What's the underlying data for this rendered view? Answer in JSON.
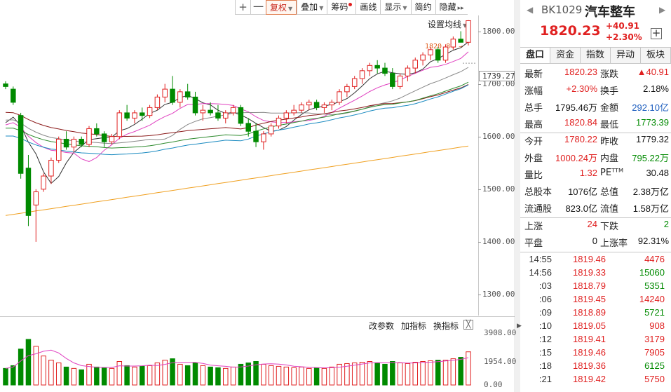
{
  "toolbar": {
    "items": [
      {
        "label": "+"
      },
      {
        "label": "一"
      },
      {
        "label": "复权"
      },
      {
        "label": "叠加"
      },
      {
        "label": "筹码"
      },
      {
        "label": "画线"
      },
      {
        "label": "显示"
      },
      {
        "label": "简约"
      },
      {
        "label": "隐藏"
      }
    ],
    "more": "▸▸"
  },
  "chart": {
    "ma_setting": "设置均线",
    "high_label": "1820.84",
    "current_price": "1739.27",
    "y_ticks": [
      "1800.00",
      "1700.00",
      "1600.00",
      "1500.00",
      "1400.00",
      "1300.00"
    ],
    "indicator_toolbar": {
      "modify_params": "改参数",
      "add_indicator": "加指标",
      "switch_indicator": "换指标"
    },
    "close_symbol": "╳",
    "volume_ticks": [
      "3908.00",
      "1954.00",
      "0.00"
    ]
  },
  "chart_data": {
    "type": "candlestick",
    "ylim": [
      1260,
      1830
    ],
    "ohlc": [
      [
        1700,
        1705,
        1690,
        1695
      ],
      [
        1690,
        1695,
        1660,
        1665
      ],
      [
        1640,
        1645,
        1520,
        1530
      ],
      [
        1540,
        1565,
        1430,
        1450
      ],
      [
        1470,
        1500,
        1400,
        1495
      ],
      [
        1500,
        1530,
        1495,
        1525
      ],
      [
        1525,
        1560,
        1510,
        1555
      ],
      [
        1555,
        1600,
        1550,
        1595
      ],
      [
        1595,
        1610,
        1575,
        1580
      ],
      [
        1580,
        1600,
        1570,
        1595
      ],
      [
        1595,
        1600,
        1580,
        1585
      ],
      [
        1585,
        1620,
        1580,
        1615
      ],
      [
        1615,
        1625,
        1600,
        1605
      ],
      [
        1605,
        1610,
        1580,
        1590
      ],
      [
        1590,
        1605,
        1585,
        1600
      ],
      [
        1600,
        1650,
        1595,
        1645
      ],
      [
        1645,
        1660,
        1630,
        1635
      ],
      [
        1635,
        1650,
        1625,
        1645
      ],
      [
        1645,
        1655,
        1630,
        1640
      ],
      [
        1640,
        1660,
        1635,
        1655
      ],
      [
        1655,
        1680,
        1650,
        1675
      ],
      [
        1675,
        1700,
        1665,
        1690
      ],
      [
        1690,
        1715,
        1660,
        1665
      ],
      [
        1665,
        1690,
        1655,
        1685
      ],
      [
        1685,
        1700,
        1670,
        1675
      ],
      [
        1675,
        1685,
        1640,
        1645
      ],
      [
        1645,
        1660,
        1630,
        1650
      ],
      [
        1650,
        1665,
        1640,
        1645
      ],
      [
        1645,
        1660,
        1630,
        1635
      ],
      [
        1635,
        1650,
        1625,
        1645
      ],
      [
        1645,
        1660,
        1640,
        1655
      ],
      [
        1655,
        1660,
        1620,
        1625
      ],
      [
        1625,
        1635,
        1600,
        1610
      ],
      [
        1610,
        1625,
        1580,
        1590
      ],
      [
        1590,
        1610,
        1575,
        1605
      ],
      [
        1605,
        1625,
        1600,
        1620
      ],
      [
        1620,
        1640,
        1615,
        1635
      ],
      [
        1635,
        1650,
        1625,
        1645
      ],
      [
        1645,
        1660,
        1640,
        1650
      ],
      [
        1650,
        1665,
        1645,
        1660
      ],
      [
        1660,
        1670,
        1650,
        1665
      ],
      [
        1665,
        1670,
        1650,
        1655
      ],
      [
        1655,
        1665,
        1645,
        1660
      ],
      [
        1660,
        1670,
        1650,
        1665
      ],
      [
        1665,
        1690,
        1660,
        1685
      ],
      [
        1685,
        1700,
        1675,
        1695
      ],
      [
        1695,
        1715,
        1690,
        1710
      ],
      [
        1710,
        1730,
        1700,
        1725
      ],
      [
        1725,
        1740,
        1715,
        1735
      ],
      [
        1735,
        1745,
        1720,
        1730
      ],
      [
        1730,
        1740,
        1715,
        1720
      ],
      [
        1720,
        1730,
        1690,
        1695
      ],
      [
        1695,
        1720,
        1690,
        1715
      ],
      [
        1715,
        1735,
        1705,
        1730
      ],
      [
        1730,
        1750,
        1720,
        1745
      ],
      [
        1745,
        1760,
        1735,
        1755
      ],
      [
        1755,
        1770,
        1745,
        1765
      ],
      [
        1765,
        1770,
        1740,
        1745
      ],
      [
        1745,
        1775,
        1740,
        1770
      ],
      [
        1770,
        1790,
        1765,
        1785
      ],
      [
        1785,
        1800,
        1780,
        1779
      ],
      [
        1779,
        1821,
        1773,
        1820
      ]
    ],
    "ma_lines": [
      {
        "color": "#333333",
        "period": 5
      },
      {
        "color": "#e040c0",
        "period": 10
      },
      {
        "color": "#888888",
        "period": 20
      },
      {
        "color": "#8b1a1a",
        "period": 30
      },
      {
        "color": "#2e8b2e",
        "period": 60
      },
      {
        "color": "#1a8ac0",
        "period": 90
      },
      {
        "color": "#f0a020",
        "period": 250
      }
    ],
    "ma250": [
      1450,
      1582
    ],
    "volume": [
      1200,
      1400,
      2600,
      3300,
      2800,
      2100,
      1800,
      1600,
      1300,
      1200,
      1100,
      1500,
      1300,
      1250,
      1200,
      1700,
      1400,
      1300,
      1350,
      1400,
      1600,
      1800,
      1900,
      1500,
      1400,
      1600,
      1400,
      1300,
      1250,
      1200,
      1300,
      1500,
      1600,
      1700,
      1500,
      1400,
      1350,
      1300,
      1250,
      1300,
      1200,
      1250,
      1200,
      1300,
      1500,
      1550,
      1600,
      1650,
      1700,
      1600,
      1500,
      1700,
      1600,
      1550,
      1650,
      1700,
      1750,
      1800,
      1800,
      1900,
      2000,
      2400
    ],
    "ylim_volume": [
      0,
      3908
    ]
  },
  "header": {
    "nav_prev": "◀",
    "nav_next": "▶",
    "code": "BK1029",
    "name": "汽车整车",
    "price": "1820.23",
    "change": "+40.91",
    "change_pct": "+2.30%",
    "add_symbol": "+"
  },
  "tabs": [
    {
      "label": "盘口"
    },
    {
      "label": "资金"
    },
    {
      "label": "指数"
    },
    {
      "label": "异动"
    },
    {
      "label": "板块"
    }
  ],
  "quote": [
    {
      "l1": "最新",
      "v1": "1820.23",
      "c1": "red",
      "l2": "涨跌",
      "v2": "▲40.91",
      "c2": "red"
    },
    {
      "l1": "涨幅",
      "v1": "+2.30%",
      "c1": "red",
      "l2": "换手",
      "v2": "2.18%",
      "c2": "blk"
    },
    {
      "l1": "总手",
      "v1": "1795.46万",
      "c1": "blk",
      "l2": "金额",
      "v2": "292.10亿",
      "c2": "blue"
    },
    {
      "l1": "最高",
      "v1": "1820.84",
      "c1": "red",
      "l2": "最低",
      "v2": "1773.39",
      "c2": "green"
    },
    {
      "l1": "今开",
      "v1": "1780.22",
      "c1": "red",
      "l2": "昨收",
      "v2": "1779.32",
      "c2": "blk"
    },
    {
      "l1": "外盘",
      "v1": "1000.24万",
      "c1": "red",
      "l2": "内盘",
      "v2": "795.22万",
      "c2": "green"
    },
    {
      "l1": "量比",
      "v1": "1.32",
      "c1": "red",
      "l2": "PEᵀᵀᴹ",
      "v2": "30.48",
      "c2": "blk"
    },
    {
      "l1": "总股本",
      "v1": "1076亿",
      "c1": "blk",
      "l2": "总值",
      "v2": "2.38万亿",
      "c2": "blk"
    },
    {
      "l1": "流通股",
      "v1": "823.0亿",
      "c1": "blk",
      "l2": "流值",
      "v2": "1.58万亿",
      "c2": "blk"
    },
    {
      "l1": "上涨",
      "v1": "24",
      "c1": "red",
      "l2": "下跌",
      "v2": "2",
      "c2": "green"
    },
    {
      "l1": "平盘",
      "v1": "0",
      "c1": "blk",
      "l2": "上涨率",
      "v2": "92.31%",
      "c2": "blk"
    }
  ],
  "ticks": [
    {
      "time": "14:55",
      "price": "1819.46",
      "vol": "4476",
      "vc": "red"
    },
    {
      "time": "14:56",
      "price": "1819.33",
      "vol": "15060",
      "vc": "green"
    },
    {
      "time": ":03",
      "price": "1818.79",
      "vol": "5351",
      "vc": "green"
    },
    {
      "time": ":06",
      "price": "1819.45",
      "vol": "14240",
      "vc": "red"
    },
    {
      "time": ":09",
      "price": "1818.89",
      "vol": "5721",
      "vc": "green"
    },
    {
      "time": ":10",
      "price": "1819.05",
      "vol": "908",
      "vc": "red"
    },
    {
      "time": ":12",
      "price": "1819.41",
      "vol": "3179",
      "vc": "red"
    },
    {
      "time": ":15",
      "price": "1819.46",
      "vol": "7905",
      "vc": "red"
    },
    {
      "time": ":18",
      "price": "1819.36",
      "vol": "6125",
      "vc": "green"
    },
    {
      "time": ":21",
      "price": "1819.42",
      "vol": "5750",
      "vc": "red"
    }
  ]
}
